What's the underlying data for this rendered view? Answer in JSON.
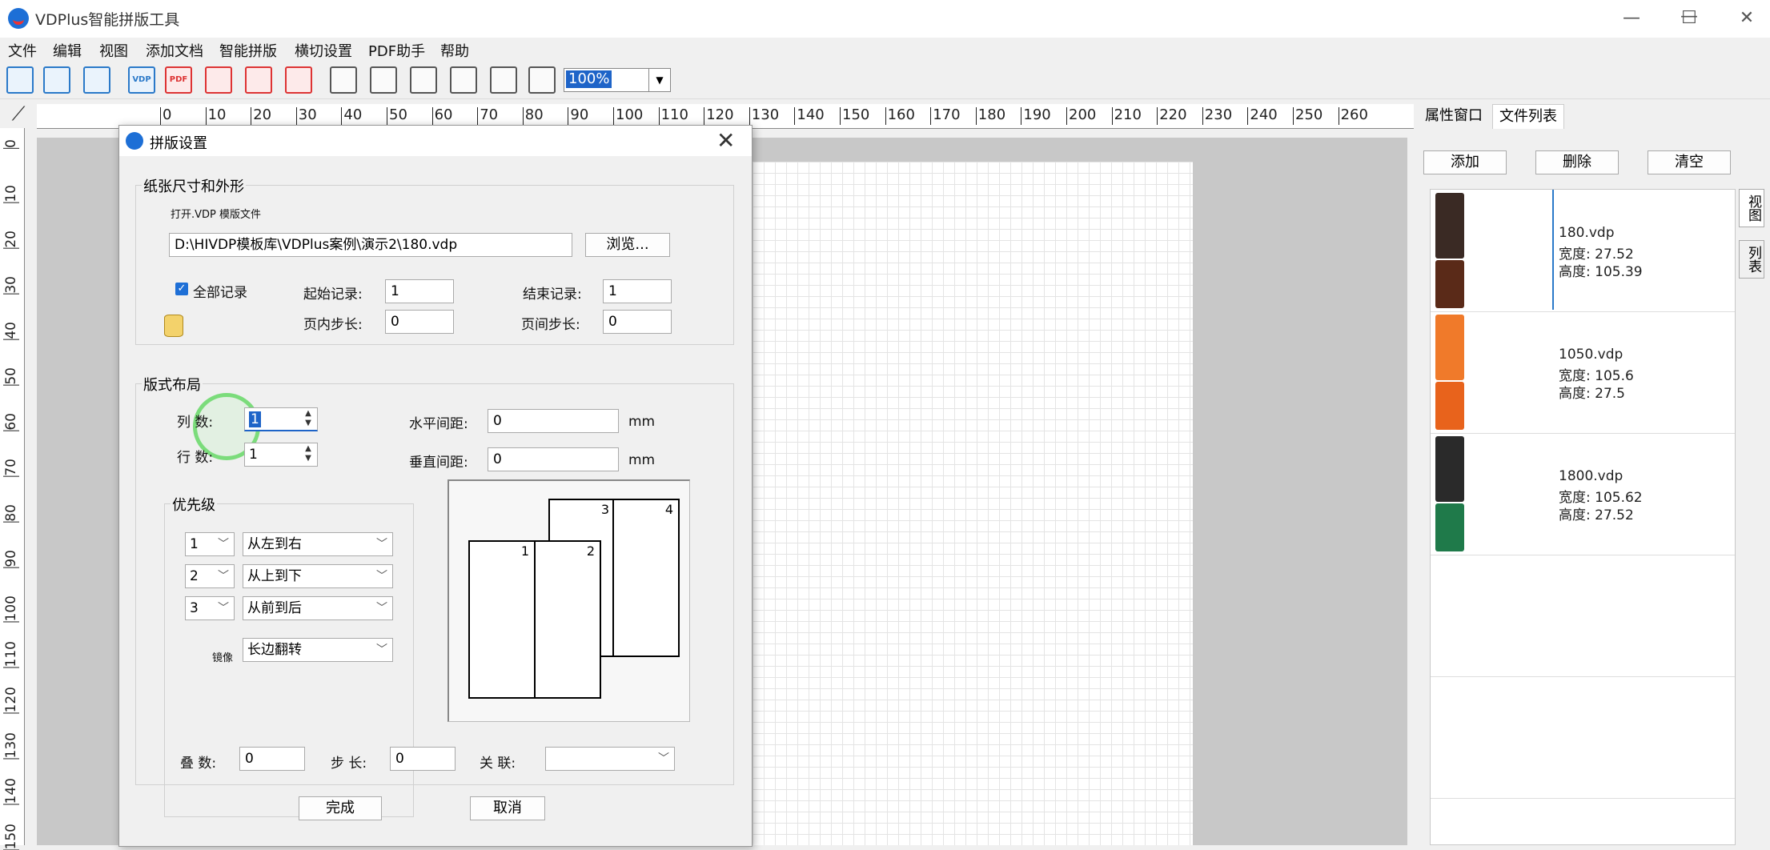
{
  "window": {
    "title": "VDPlus智能拼版工具",
    "min": "—",
    "max": "☐",
    "close": "✕"
  },
  "menu": [
    "文件",
    "编辑",
    "视图",
    "添加文档",
    "智能拼版",
    "横切设置",
    "PDF助手",
    "帮助"
  ],
  "toolbar": {
    "icons": [
      "new-doc-icon",
      "edit-doc-icon",
      "save-icon",
      "open-vdp-icon",
      "open-pdf-icon",
      "pdf-search-icon",
      "pdf-export-icon",
      "pdf-split-icon",
      "select-arrow-icon",
      "hand-icon",
      "text-tool-icon",
      "rotate-icon",
      "zoom-in-icon",
      "zoom-out-icon"
    ],
    "vdp_label": "VDP",
    "pdf_label": "PDF",
    "zoom": "100%"
  },
  "ruler": {
    "h_ticks": [
      "0",
      "10",
      "20",
      "30",
      "40",
      "50",
      "60",
      "70",
      "80",
      "90",
      "100",
      "110",
      "120",
      "130",
      "140",
      "150",
      "160",
      "170",
      "180",
      "190",
      "200",
      "210",
      "220",
      "230",
      "240",
      "250",
      "260"
    ],
    "v_ticks": [
      "0",
      "10",
      "20",
      "30",
      "40",
      "50",
      "60",
      "70",
      "80",
      "90",
      "100",
      "110",
      "120",
      "130",
      "140",
      "150"
    ]
  },
  "right_panel": {
    "tabs": [
      "属性窗口",
      "文件列表"
    ],
    "buttons": {
      "add": "添加",
      "delete": "删除",
      "clear": "清空"
    },
    "side_tabs": [
      "视图",
      "列表"
    ],
    "files": [
      {
        "name": "180.vdp",
        "width": "宽度: 27.52",
        "height": "高度: 105.39",
        "colors": [
          "#3a2a24",
          "#5a2a18"
        ]
      },
      {
        "name": "1050.vdp",
        "width": "宽度: 105.6",
        "height": "高度: 27.5",
        "colors": [
          "#f07a2a",
          "#e8631c"
        ]
      },
      {
        "name": "1800.vdp",
        "width": "宽度: 105.62",
        "height": "高度: 27.52",
        "colors": [
          "#2a2a2a",
          "#1f7a4a"
        ]
      }
    ]
  },
  "dialog": {
    "title": "拼版设置",
    "close": "✕",
    "paper_group": {
      "title": "纸张尺寸和外形",
      "open_label": "打开.VDP 模版文件",
      "path": "D:\\HIVDP模板库\\VDPlus案例\\演示2\\180.vdp",
      "browse": "浏览...",
      "all_records": "全部记录",
      "start_label": "起始记录:",
      "start_value": "1",
      "end_label": "结束记录:",
      "end_value": "1",
      "inpage_step_label": "页内步长:",
      "inpage_step_value": "0",
      "page_step_label": "页间步长:",
      "page_step_value": "0"
    },
    "layout_group": {
      "title": "版式布局",
      "cols_label": "列  数:",
      "cols_value": "1",
      "rows_label": "行  数:",
      "rows_value": "1",
      "h_gap_label": "水平间距:",
      "h_gap_value": "0",
      "v_gap_label": "垂直间距:",
      "v_gap_value": "0",
      "unit": "mm",
      "priority_title": "优先级",
      "priorities": [
        {
          "num": "1",
          "dir": "从左到右"
        },
        {
          "num": "2",
          "dir": "从上到下"
        },
        {
          "num": "3",
          "dir": "从前到后"
        }
      ],
      "mirror_label": "镜像",
      "mirror_value": "长边翻转",
      "preview_pages": [
        "1",
        "2",
        "3",
        "4"
      ],
      "stack_label": "叠  数:",
      "stack_value": "0",
      "step_label": "步  长:",
      "step_value": "0",
      "link_label": "关  联:",
      "link_value": ""
    },
    "ok": "完成",
    "cancel": "取消"
  }
}
